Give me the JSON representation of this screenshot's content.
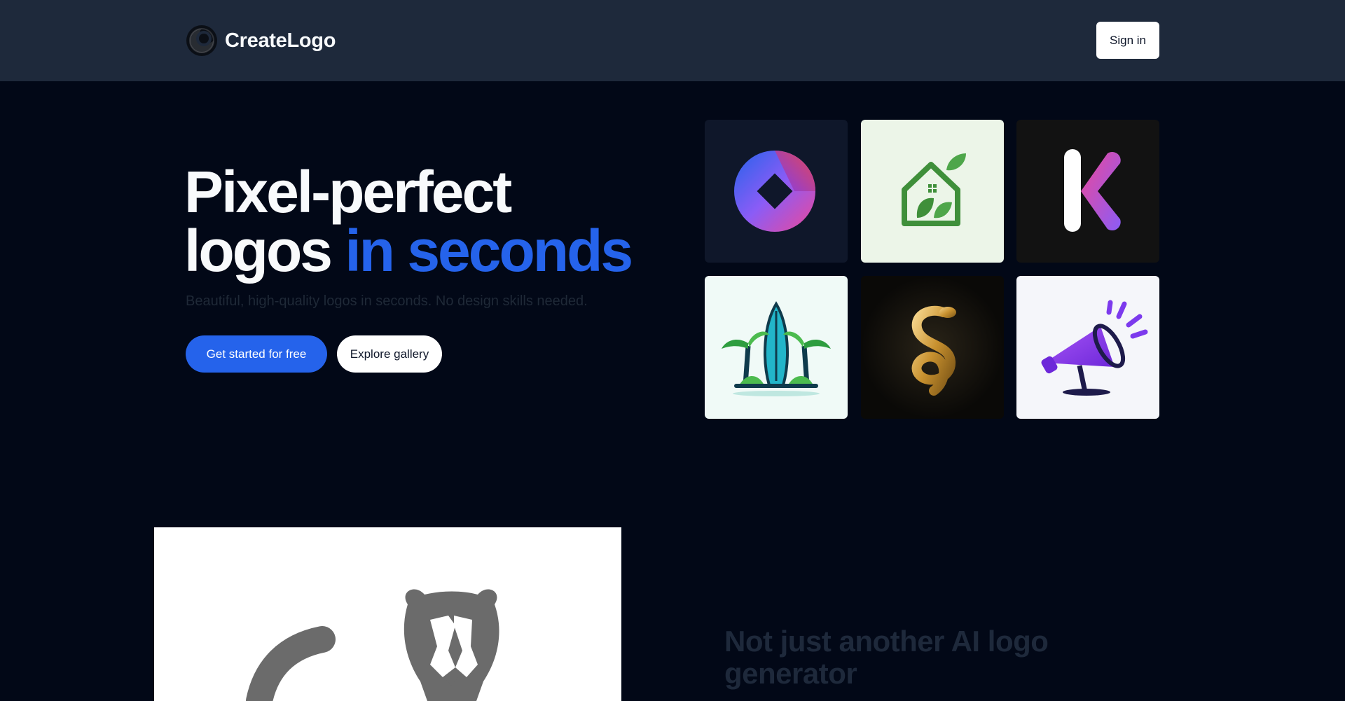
{
  "header": {
    "brand_name": "CreateLogo",
    "sign_in_label": "Sign in"
  },
  "hero": {
    "title_line1": "Pixel-perfect",
    "title_line2_plain": "logos ",
    "title_line2_accent": "in seconds",
    "subtitle": "Beautiful, high-quality logos in seconds. No design skills needed.",
    "primary_cta": "Get started for free",
    "secondary_cta": "Explore gallery"
  },
  "gallery": {
    "tiles": [
      {
        "name": "gradient-loop-logo"
      },
      {
        "name": "leaf-house-logo"
      },
      {
        "name": "letter-k-logo"
      },
      {
        "name": "palm-surfboard-logo"
      },
      {
        "name": "golden-snake-logo"
      },
      {
        "name": "megaphone-logo"
      }
    ]
  },
  "feature": {
    "title": "Not just another AI logo generator"
  },
  "colors": {
    "header_bg": "#1e293b",
    "page_bg": "#020817",
    "accent": "#2563eb"
  }
}
